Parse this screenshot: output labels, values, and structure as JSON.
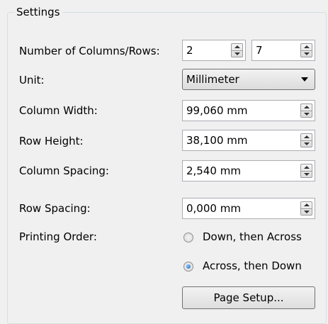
{
  "group": {
    "title": "Settings"
  },
  "columns_rows": {
    "label": "Number of Columns/Rows:",
    "columns": "2",
    "rows": "7"
  },
  "unit": {
    "label": "Unit:",
    "selected": "Millimeter"
  },
  "column_width": {
    "label": "Column Width:",
    "value": "99,060 mm"
  },
  "row_height": {
    "label": "Row Height:",
    "value": "38,100 mm"
  },
  "column_spacing": {
    "label": "Column Spacing:",
    "value": "2,540 mm"
  },
  "row_spacing": {
    "label": "Row Spacing:",
    "value": "0,000 mm"
  },
  "printing_order": {
    "label": "Printing Order:",
    "options": [
      {
        "label": "Down, then Across",
        "checked": false
      },
      {
        "label": "Across, then Down",
        "checked": true
      }
    ]
  },
  "page_setup": {
    "label": "Page Setup..."
  }
}
